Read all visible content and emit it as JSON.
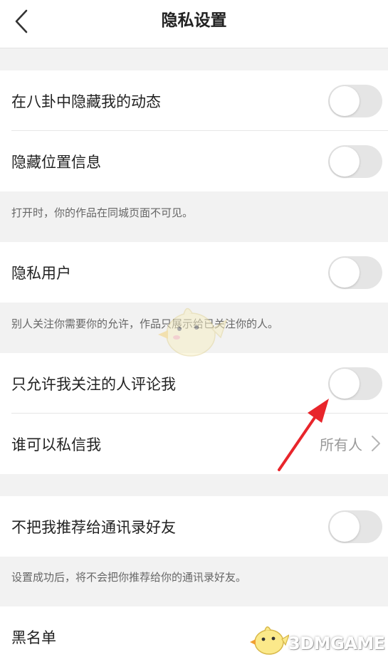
{
  "header": {
    "title": "隐私设置",
    "back_icon": "chevron-left-icon"
  },
  "settings": {
    "hide_in_gossip": {
      "label": "在八卦中隐藏我的动态",
      "enabled": false
    },
    "hide_location": {
      "label": "隐藏位置信息",
      "enabled": false,
      "hint": "打开时，你的作品在同城页面不可见。"
    },
    "private_user": {
      "label": "隐私用户",
      "enabled": false,
      "hint": "别人关注你需要你的允许，作品只展示给已关注你的人。"
    },
    "only_following_comment": {
      "label": "只允许我关注的人评论我",
      "enabled": false
    },
    "who_can_message": {
      "label": "谁可以私信我",
      "value": "所有人"
    },
    "no_recommend_contacts": {
      "label": "不把我推荐给通讯录好友",
      "enabled": false,
      "hint": "设置成功后，将不会把你推荐给你的通讯录好友。"
    },
    "blacklist": {
      "label": "黑名单"
    }
  },
  "watermark": {
    "text": "3DMGAME"
  },
  "colors": {
    "background": "#f2f2f2",
    "toggle_off": "#e5e5e5",
    "annotation_arrow": "#e8252b"
  }
}
